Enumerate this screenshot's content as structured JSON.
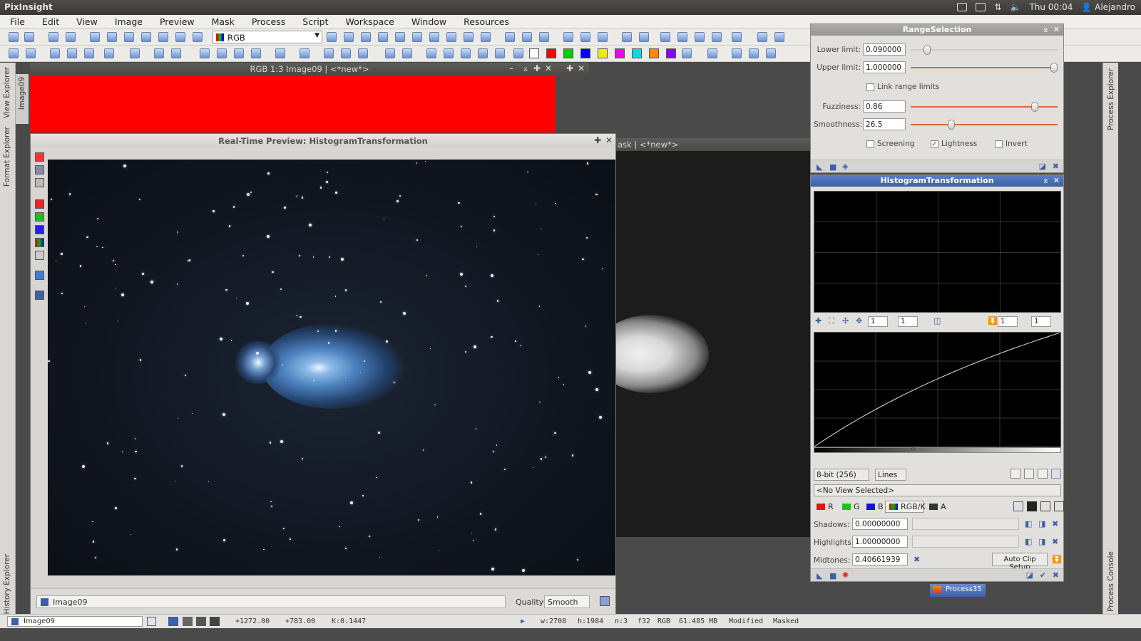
{
  "sysbar": {
    "title": "PixInsight",
    "clock": "Thu 00:04",
    "user": "Alejandro"
  },
  "menu": [
    "File",
    "Edit",
    "View",
    "Image",
    "Preview",
    "Mask",
    "Process",
    "Script",
    "Workspace",
    "Window",
    "Resources"
  ],
  "toolbar": {
    "channel_select": "RGB"
  },
  "left_tabs": {
    "view_explorer": "View Explorer",
    "format_explorer": "Format Explorer",
    "history_explorer": "History Explorer",
    "image_tab": "Image09"
  },
  "right_tabs": {
    "process_explorer": "Process Explorer",
    "process_console": "Process Console"
  },
  "rgb_window": {
    "title": "RGB 1:3 Image09 | <*new*>"
  },
  "mask_window": {
    "title": "ask | <*new*>"
  },
  "preview": {
    "title": "Real-Time Preview: HistogramTransformation",
    "view": "Image09",
    "quality_label": "Quality:",
    "quality_value": "Smooth"
  },
  "range_selection": {
    "title": "RangeSelection",
    "lower_limit_label": "Lower limit:",
    "lower_limit": "0.090000",
    "upper_limit_label": "Upper limit:",
    "upper_limit": "1.000000",
    "link_label": "Link range limits",
    "fuzziness_label": "Fuzziness:",
    "fuzziness": "0.86",
    "smoothness_label": "Smoothness:",
    "smoothness": "26.5",
    "screening_label": "Screening",
    "lightness_label": "Lightness",
    "invert_label": "Invert",
    "lower_fraction": 0.09,
    "upper_fraction": 1.0,
    "fuzziness_fraction": 0.86,
    "smoothness_fraction": 0.265
  },
  "histogram": {
    "title": "HistogramTransformation",
    "zoom_h": "1",
    "zoom_v": "1",
    "zoom_h2": "1",
    "zoom_v2": "1",
    "resolution": "8-bit (256)",
    "graph_style": "Lines",
    "view_select": "<No View Selected>",
    "channels": {
      "r": "R",
      "g": "G",
      "b": "B",
      "rgbk": "RGB/K",
      "a": "A"
    },
    "shadows_label": "Shadows:",
    "shadows": "0.00000000",
    "highlights_label": "Highlights:",
    "highlights": "1.00000000",
    "midtones_label": "Midtones:",
    "midtones": "0.40661939",
    "auto_clip": "Auto Clip Setup"
  },
  "process_icons": {
    "process35": "Process35"
  },
  "status": {
    "view": "Image09",
    "x": "+1272.00",
    "y": "+783.00",
    "k": "K:0.1447",
    "w": "w:2708",
    "h": "h:1984",
    "n": "n:3",
    "f": "f32",
    "space": "RGB",
    "mem": "61.485 MB",
    "modified": "Modified",
    "masked": "Masked"
  },
  "colors": {
    "accent": "#3c5fa6",
    "red_image": "#ff0000"
  }
}
